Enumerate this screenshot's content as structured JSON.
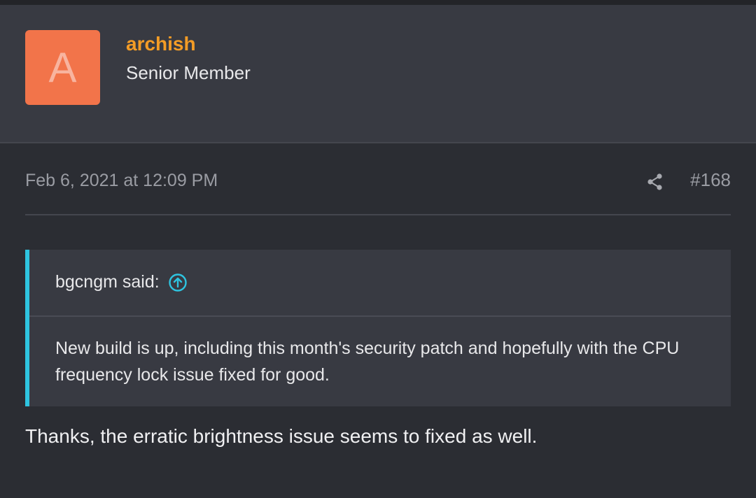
{
  "user": {
    "avatar_letter": "A",
    "name": "archish",
    "title": "Senior Member"
  },
  "post": {
    "date": "Feb 6, 2021 at 12:09 PM",
    "number": "#168",
    "share_icon": "share-icon",
    "body": "Thanks, the erratic brightness issue seems to fixed as well."
  },
  "quote": {
    "author_label": "bgcngm said:",
    "jump_icon": "arrow-up-circle-icon",
    "text": "New build is up, including this month's security patch and hopefully with the CPU frequency lock issue fixed for good."
  },
  "colors": {
    "background": "#2b2d33",
    "header_bg": "#383a42",
    "avatar_bg": "#f2744a",
    "username": "#f39c26",
    "quote_accent": "#2ec4e0",
    "muted_text": "#9a9ca3"
  }
}
